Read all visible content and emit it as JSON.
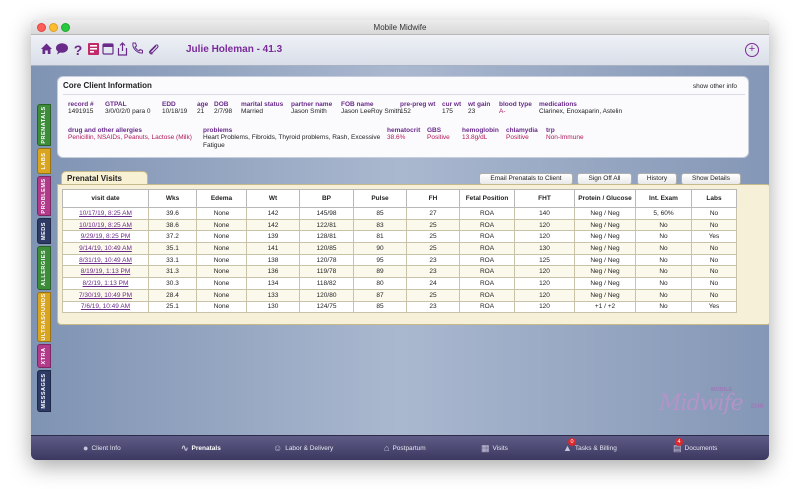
{
  "window": {
    "title": "Mobile Midwife"
  },
  "header": {
    "client_name": "Julie Holeman - 41.3"
  },
  "toolbar_icons": [
    "home-icon",
    "chat-icon",
    "help-icon",
    "chart-icon",
    "export-icon",
    "phone-icon",
    "attachment-icon"
  ],
  "side_tabs": [
    {
      "label": "PRENATALS",
      "color": "#3c8c3a"
    },
    {
      "label": "LABS",
      "color": "#d9a520"
    },
    {
      "label": "PROBLEMS",
      "color": "#b23a8a"
    },
    {
      "label": "MEDS",
      "color": "#2d3a66"
    },
    {
      "label": "ALLERGIES",
      "color": "#3c8c3a"
    },
    {
      "label": "ULTRASOUNDS",
      "color": "#d9a520"
    },
    {
      "label": "XTRA",
      "color": "#b23a8a"
    },
    {
      "label": "MESSAGES",
      "color": "#2d3a66"
    }
  ],
  "core_client_info": {
    "title": "Core Client Information",
    "show_other_info": "show other info",
    "fields": {
      "record": {
        "label": "record #",
        "value": "1491915"
      },
      "gtpal": {
        "label": "GTPAL",
        "value": "3/0/0/2/0 para 0"
      },
      "edd": {
        "label": "EDD",
        "value": "10/18/19"
      },
      "age": {
        "label": "age",
        "value": "21"
      },
      "dob": {
        "label": "DOB",
        "value": "2/7/98"
      },
      "marital_status": {
        "label": "marital status",
        "value": "Married"
      },
      "partner_name": {
        "label": "partner name",
        "value": "Jason Smith"
      },
      "fob_name": {
        "label": "FOB name",
        "value": "Jason LeeRoy Smith"
      },
      "pre_preg_wt": {
        "label": "pre-preg wt",
        "value": "152"
      },
      "cur_wt": {
        "label": "cur wt",
        "value": "175"
      },
      "wt_gain": {
        "label": "wt gain",
        "value": "23"
      },
      "blood_type": {
        "label": "blood type",
        "value": "A-"
      },
      "medications": {
        "label": "medications",
        "value": "Clarinex, Enoxaparin, Astelin"
      },
      "allergies": {
        "label": "drug and other allergies",
        "value": "Penicillin, NSAIDs, Peanuts, Lactose (Milk)"
      },
      "problems": {
        "label": "problems",
        "value": "Heart Problems, Fibroids, Thyroid problems, Rash, Excessive Fatigue"
      },
      "hematocrit": {
        "label": "hematocrit",
        "value": "38.6%"
      },
      "gbs": {
        "label": "GBS",
        "value": "Positive"
      },
      "hemoglobin": {
        "label": "hemoglobin",
        "value": "13.8g/dL"
      },
      "chlamydia": {
        "label": "chlamydia",
        "value": "Positive"
      },
      "trp": {
        "label": "trp",
        "value": "Non-Immune"
      }
    }
  },
  "prenatal_visits": {
    "tab_label": "Prenatal Visits",
    "buttons": {
      "email": "Email Prenatals to Client",
      "sign_off": "Sign Off All",
      "history": "History",
      "show_details": "Show Details"
    },
    "columns": [
      "visit date",
      "Wks",
      "Edema",
      "Wt",
      "BP",
      "Pulse",
      "FH",
      "Fetal Position",
      "FHT",
      "Protein / Glucose",
      "Int. Exam",
      "Labs"
    ],
    "rows": [
      [
        "10/17/19, 8:25 AM",
        "39.6",
        "None",
        "142",
        "145/98",
        "85",
        "27",
        "ROA",
        "140",
        "Neg / Neg",
        "5, 60%",
        "No"
      ],
      [
        "10/10/19, 8:25 AM",
        "38.6",
        "None",
        "142",
        "122/81",
        "83",
        "25",
        "ROA",
        "120",
        "Neg / Neg",
        "No",
        "No"
      ],
      [
        "9/29/19, 8:25 PM",
        "37.2",
        "None",
        "139",
        "128/81",
        "81",
        "25",
        "ROA",
        "120",
        "Neg / Neg",
        "No",
        "Yes"
      ],
      [
        "9/14/19, 10:49 AM",
        "35.1",
        "None",
        "141",
        "120/85",
        "90",
        "25",
        "ROA",
        "130",
        "Neg / Neg",
        "No",
        "No"
      ],
      [
        "8/31/19, 10:49 AM",
        "33.1",
        "None",
        "138",
        "120/78",
        "95",
        "23",
        "ROA",
        "125",
        "Neg / Neg",
        "No",
        "No"
      ],
      [
        "8/19/19, 1:13 PM",
        "31.3",
        "None",
        "136",
        "119/78",
        "89",
        "23",
        "ROA",
        "120",
        "Neg / Neg",
        "No",
        "No"
      ],
      [
        "8/2/19, 1:13 PM",
        "30.3",
        "None",
        "134",
        "118/82",
        "80",
        "24",
        "ROA",
        "120",
        "Neg / Neg",
        "No",
        "No"
      ],
      [
        "7/30/19, 10:49 PM",
        "28.4",
        "None",
        "133",
        "120/80",
        "87",
        "25",
        "ROA",
        "120",
        "Neg / Neg",
        "No",
        "No"
      ],
      [
        "7/6/19, 10:49 AM",
        "25.1",
        "None",
        "130",
        "124/75",
        "85",
        "23",
        "ROA",
        "120",
        "+1 / +2",
        "No",
        "Yes"
      ]
    ]
  },
  "logo": {
    "main": "Midwife",
    "top": "MOBILE",
    "side": "EHR"
  },
  "bottom_nav": [
    {
      "label": "Client Info",
      "icon": "person-icon",
      "badge": ""
    },
    {
      "label": "Prenatals",
      "icon": "pulse-icon",
      "badge": ""
    },
    {
      "label": "Labor & Delivery",
      "icon": "baby-icon",
      "badge": ""
    },
    {
      "label": "Postpartum",
      "icon": "house-icon",
      "badge": ""
    },
    {
      "label": "Visits",
      "icon": "car-icon",
      "badge": ""
    },
    {
      "label": "Tasks & Billing",
      "icon": "tasks-icon",
      "badge": "0"
    },
    {
      "label": "Documents",
      "icon": "documents-icon",
      "badge": "4"
    }
  ]
}
